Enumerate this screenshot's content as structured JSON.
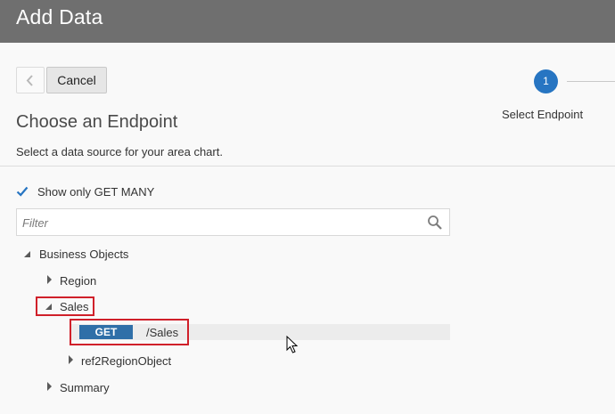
{
  "header": {
    "title": "Add Data"
  },
  "nav": {
    "cancel_label": "Cancel"
  },
  "stepper": {
    "step_number": "1",
    "step_label": "Select Endpoint"
  },
  "page": {
    "heading": "Choose an Endpoint",
    "subtitle": "Select a data source for your area chart."
  },
  "filter_options": {
    "show_only_label": "Show only GET MANY",
    "show_only_checked": true
  },
  "filter": {
    "placeholder": "Filter",
    "value": ""
  },
  "tree": {
    "root": {
      "label": "Business Objects",
      "expanded": true
    },
    "region": {
      "label": "Region",
      "expanded": false
    },
    "sales": {
      "label": "Sales",
      "expanded": true
    },
    "endpoint": {
      "method": "GET",
      "path": "/Sales"
    },
    "ref": {
      "label": "ref2RegionObject",
      "expanded": false
    },
    "summary": {
      "label": "Summary",
      "expanded": false
    }
  },
  "colors": {
    "accent": "#2775c2",
    "badge": "#2f6fa8",
    "callout": "#d0202a",
    "titlebar": "#6f6f6f"
  },
  "icons": [
    "chevron-left-icon",
    "checkmark-icon",
    "search-icon",
    "triangle-down-icon",
    "triangle-right-icon",
    "mouse-cursor-icon"
  ]
}
